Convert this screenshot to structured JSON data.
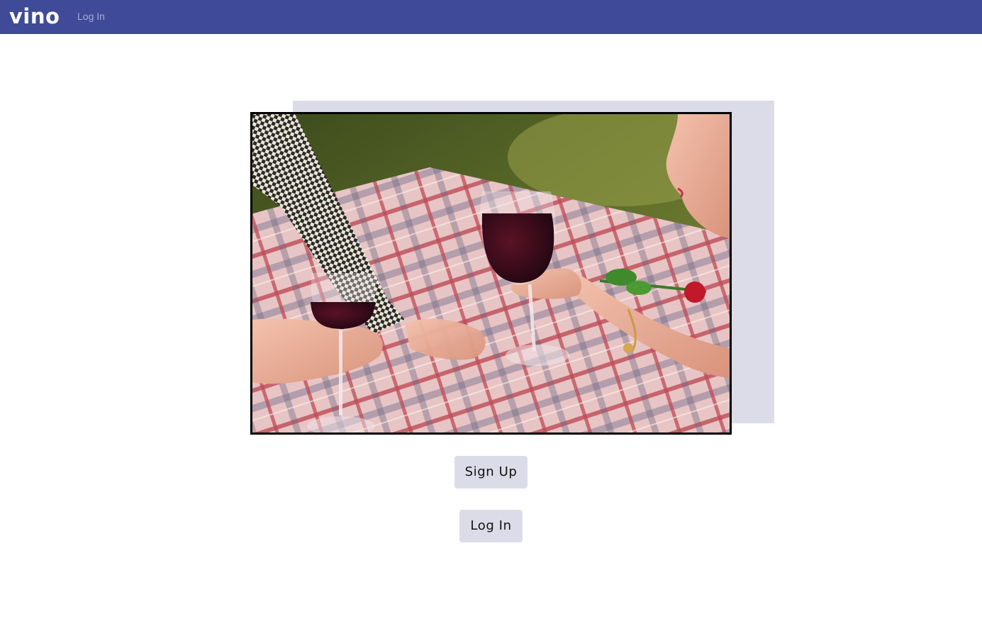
{
  "navbar": {
    "brand": "vino",
    "login_link": "Log In",
    "background_color": "#3f4b99"
  },
  "hero": {
    "image_description_icon": "picnic-photo",
    "backdrop_color": "#dcdce9"
  },
  "actions": {
    "signup_label": "Sign Up",
    "login_label": "Log In",
    "button_color": "#dcdce9"
  }
}
